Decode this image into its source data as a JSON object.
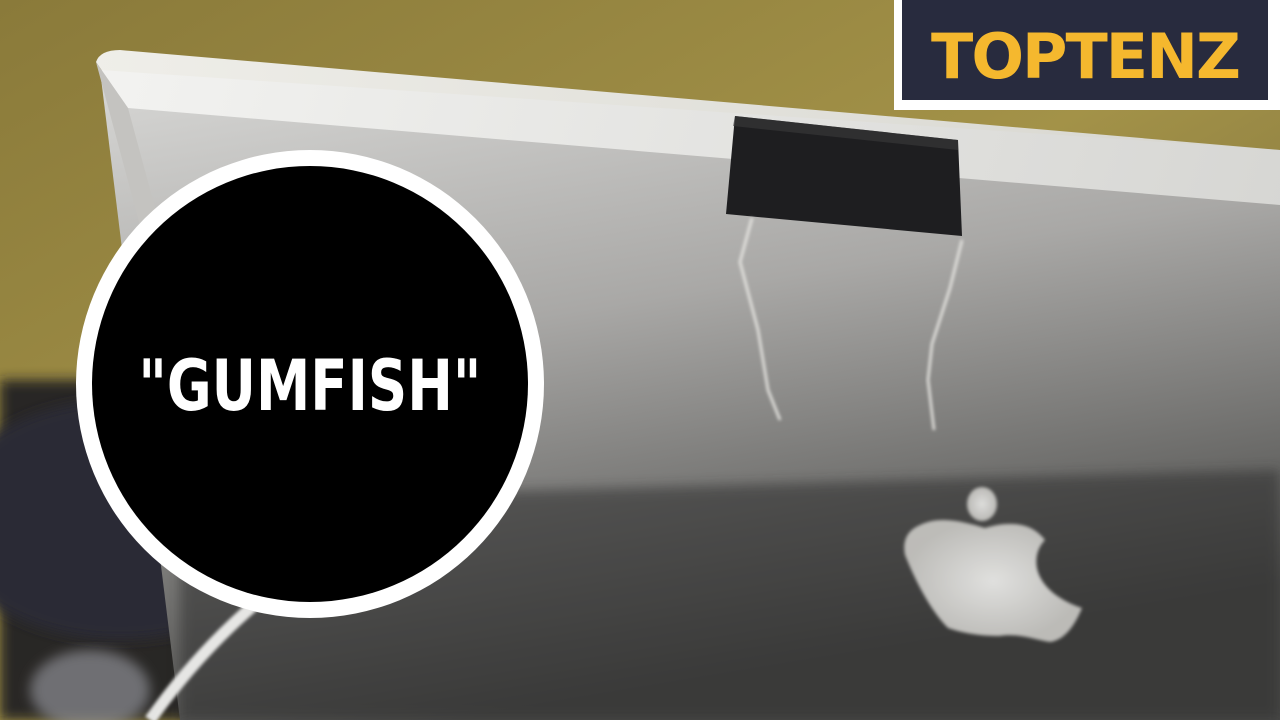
{
  "overlay": {
    "title": "\"GUMFISH\""
  },
  "brand": {
    "logo_text": "TOPTENZ",
    "logo_color": "#f5b82e",
    "logo_bg": "#282b3e",
    "logo_border": "#ffffff"
  },
  "photo": {
    "subject": "apple-logo-icon"
  }
}
